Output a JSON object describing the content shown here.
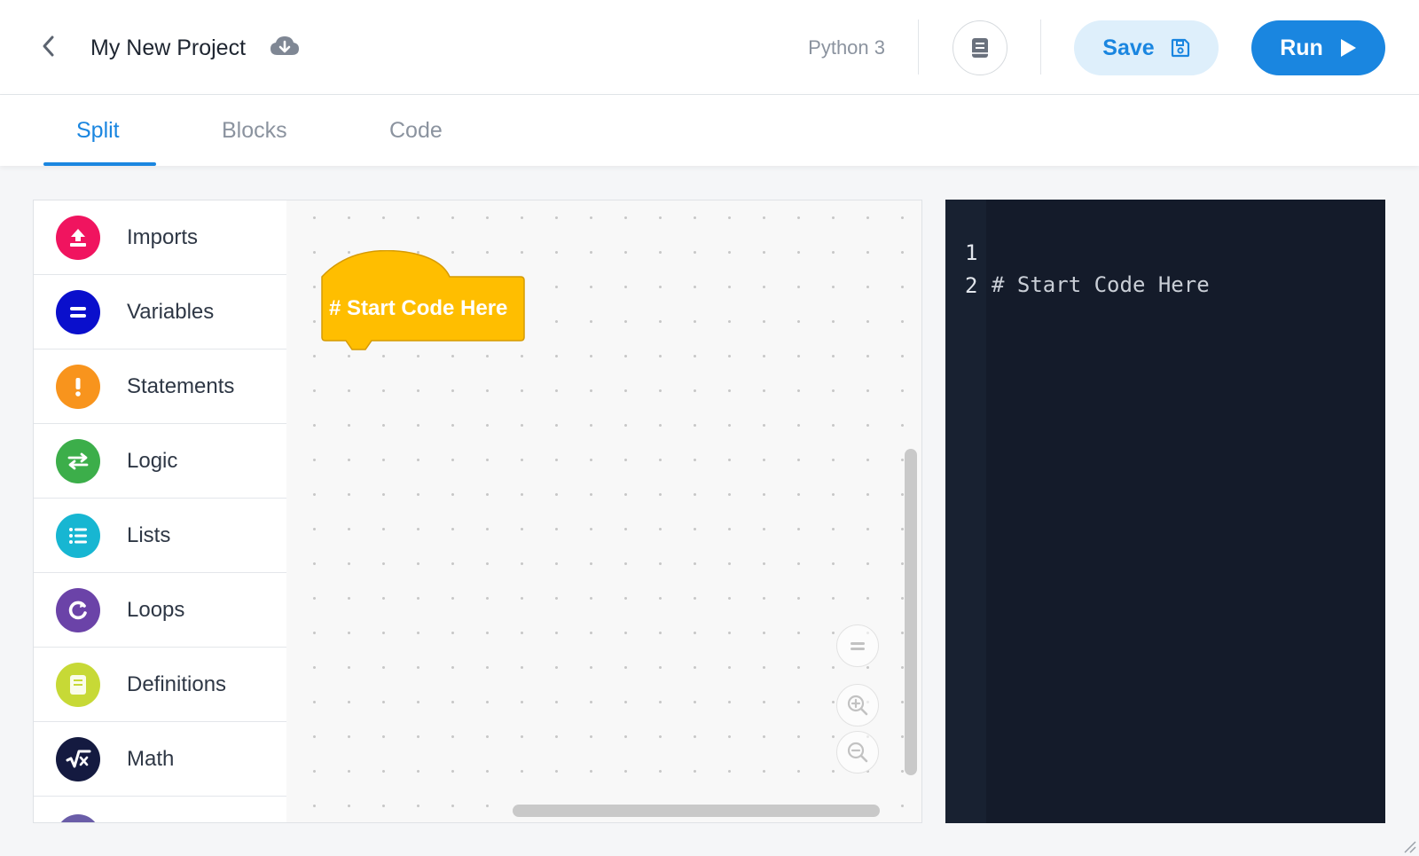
{
  "header": {
    "project_title": "My New Project",
    "language": "Python 3",
    "save_label": "Save",
    "run_label": "Run"
  },
  "tabs": [
    {
      "label": "Split",
      "active": true
    },
    {
      "label": "Blocks",
      "active": false
    },
    {
      "label": "Code",
      "active": false
    }
  ],
  "toolbox": {
    "categories": [
      {
        "label": "Imports",
        "icon": "upload-icon",
        "color": "#f0145f"
      },
      {
        "label": "Variables",
        "icon": "equals-icon",
        "color": "#0a0fcc"
      },
      {
        "label": "Statements",
        "icon": "exclamation-icon",
        "color": "#f8941d"
      },
      {
        "label": "Logic",
        "icon": "swap-arrows-icon",
        "color": "#3cae4a"
      },
      {
        "label": "Lists",
        "icon": "list-icon",
        "color": "#17b6d2"
      },
      {
        "label": "Loops",
        "icon": "loop-icon",
        "color": "#6b43a8"
      },
      {
        "label": "Definitions",
        "icon": "book-icon",
        "color": "#c7d936"
      },
      {
        "label": "Math",
        "icon": "sqrt-icon",
        "color": "#141a40"
      }
    ]
  },
  "workspace": {
    "block_label": "# Start Code Here",
    "block_color": "#ffbe00"
  },
  "code_editor": {
    "lines": [
      {
        "number": "1",
        "text": "# Start Code Here"
      },
      {
        "number": "2",
        "text": ""
      }
    ]
  },
  "colors": {
    "accent": "#1a86e0",
    "accent_light": "#deeffb",
    "editor_bg": "#141b2a"
  }
}
